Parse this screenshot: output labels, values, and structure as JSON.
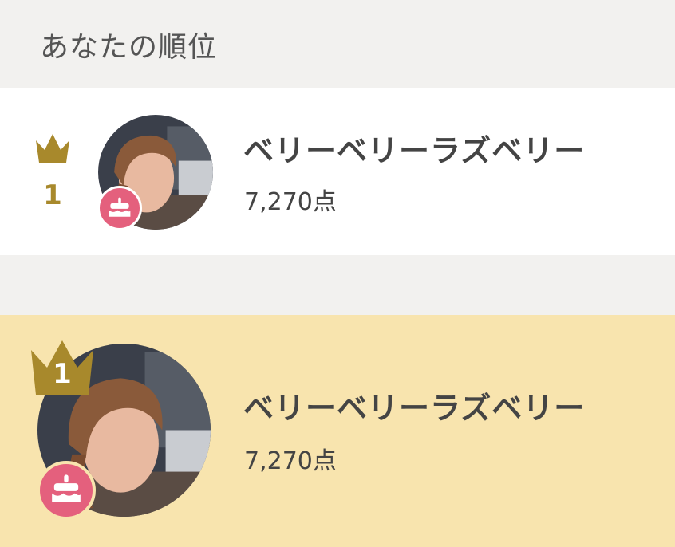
{
  "section": {
    "title": "あなたの順位"
  },
  "my_rank": {
    "rank": "1",
    "name": "ベリーベリーラズベリー",
    "score": "7,270点",
    "badge_icon": "cake-icon"
  },
  "ranking": {
    "entries": [
      {
        "rank": "1",
        "name": "ベリーベリーラズベリー",
        "score": "7,270点",
        "badge_icon": "cake-icon"
      }
    ]
  },
  "colors": {
    "accent_gold": "#a8892c",
    "highlight_bg": "#f8e4ae",
    "badge_pink": "#e4607d",
    "page_bg": "#f2f1ef"
  }
}
